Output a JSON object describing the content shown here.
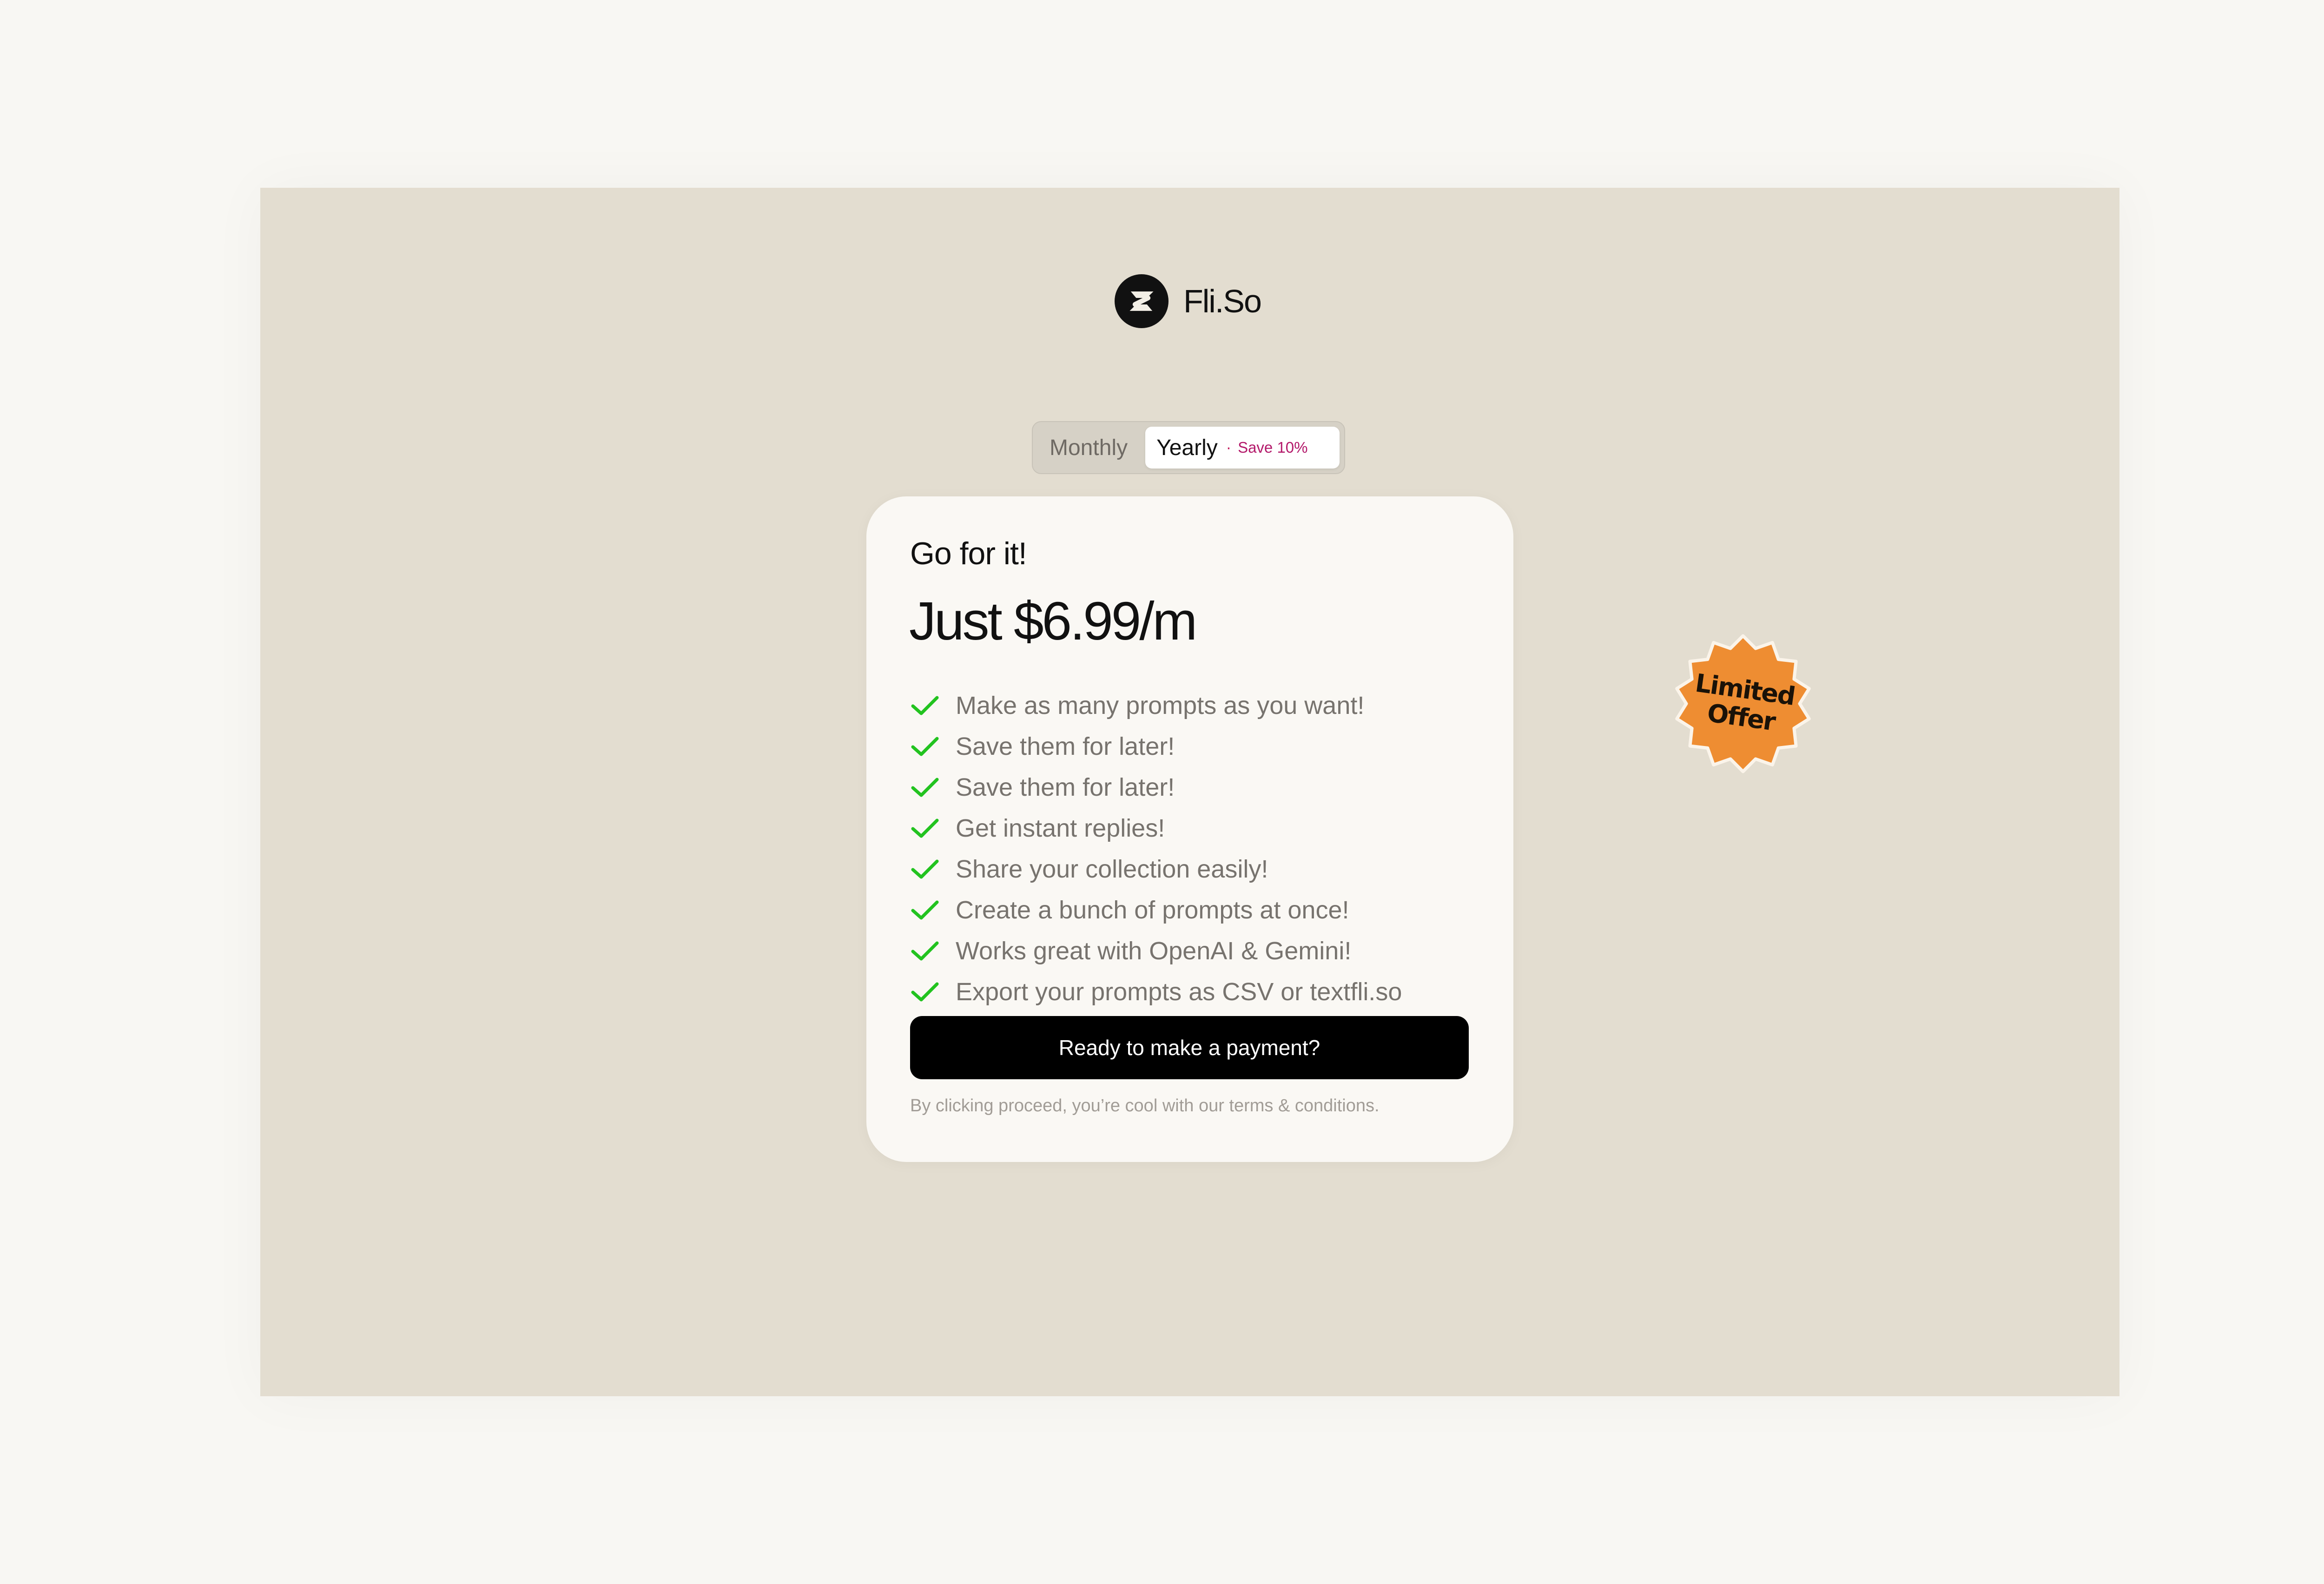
{
  "brand": {
    "name": "Fli.So",
    "logo_icon": "fliso-logo-icon"
  },
  "billing_toggle": {
    "monthly_label": "Monthly",
    "yearly_label": "Yearly",
    "separator": "·",
    "save_label": "Save 10%",
    "selected": "Yearly"
  },
  "badge": {
    "line1": "Limited",
    "line2": "Offer",
    "color": "#ee8d32"
  },
  "plan": {
    "heading": "Go for it!",
    "price": "Just $6.99/m",
    "features": [
      "Make as many prompts as you want!",
      "Save them for later!",
      "Save them for later!",
      "Get instant replies!",
      "Share your collection easily!",
      "Create a bunch of prompts at once!",
      "Works great with OpenAI & Gemini!",
      "Export your prompts as CSV or textfli.so"
    ],
    "check_icon": "check-icon",
    "check_color": "#22c31f",
    "button_label": "Ready to make a payment?",
    "terms": "By clicking proceed, you’re cool with our terms & conditions."
  },
  "colors": {
    "page_background": "#f8f7f3",
    "frame_background": "#e3ddd0",
    "card_background": "#faf8f4",
    "button_background": "#000000",
    "save_accent": "#b3186a"
  }
}
